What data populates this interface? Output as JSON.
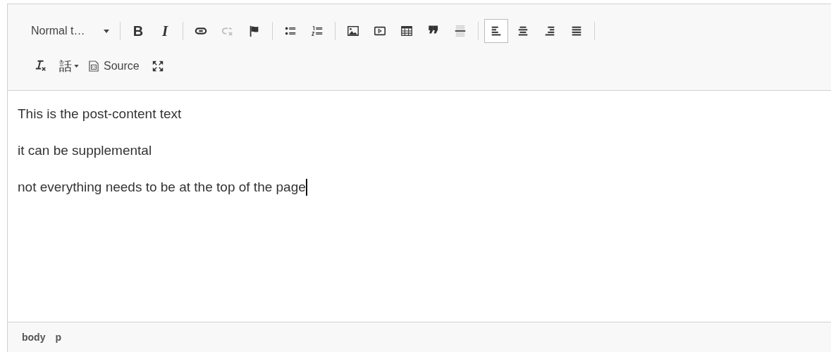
{
  "toolbar": {
    "rows": [
      {
        "items": [
          {
            "kind": "format",
            "label": "Normal t…",
            "disabled": false,
            "selected": false
          },
          {
            "kind": "separator"
          },
          {
            "kind": "bold",
            "label": "B",
            "disabled": false,
            "selected": false
          },
          {
            "kind": "italic",
            "label": "I",
            "disabled": false,
            "selected": false
          },
          {
            "kind": "separator"
          },
          {
            "kind": "link",
            "disabled": false,
            "selected": false
          },
          {
            "kind": "unlink",
            "disabled": true,
            "selected": false
          },
          {
            "kind": "anchor",
            "disabled": false,
            "selected": false
          },
          {
            "kind": "separator"
          },
          {
            "kind": "bullets",
            "disabled": false,
            "selected": false
          },
          {
            "kind": "numbers",
            "disabled": false,
            "selected": false
          },
          {
            "kind": "separator"
          },
          {
            "kind": "image",
            "disabled": false,
            "selected": false
          },
          {
            "kind": "video",
            "disabled": false,
            "selected": false
          },
          {
            "kind": "table",
            "disabled": false,
            "selected": false
          },
          {
            "kind": "quote",
            "label": "❞",
            "disabled": false,
            "selected": false
          },
          {
            "kind": "rule",
            "disabled": false,
            "selected": false
          },
          {
            "kind": "separator"
          },
          {
            "kind": "align-left",
            "disabled": false,
            "selected": true
          },
          {
            "kind": "align-center",
            "disabled": false,
            "selected": false
          },
          {
            "kind": "align-right",
            "disabled": false,
            "selected": false
          },
          {
            "kind": "justify",
            "disabled": false,
            "selected": false
          },
          {
            "kind": "separator"
          }
        ]
      },
      {
        "items": [
          {
            "kind": "remove-format",
            "disabled": false,
            "selected": false
          },
          {
            "kind": "language",
            "label": "話",
            "disabled": false,
            "selected": false
          },
          {
            "kind": "source",
            "label": "Source",
            "disabled": false,
            "selected": false
          },
          {
            "kind": "maximize",
            "disabled": false,
            "selected": false
          }
        ]
      }
    ]
  },
  "content": {
    "paragraphs": [
      {
        "text": "This is the post-content text",
        "cursor": false
      },
      {
        "text": "it can be supplemental",
        "cursor": false
      },
      {
        "text": "not everything needs to be at the top of the page",
        "cursor": true
      }
    ]
  },
  "status_bar": {
    "path": [
      "body",
      "p"
    ]
  }
}
